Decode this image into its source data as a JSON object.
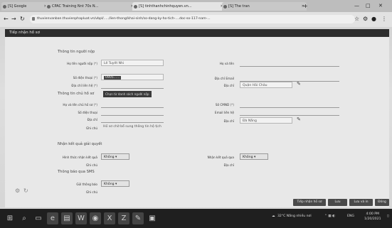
{
  "browser": {
    "tabs": [
      {
        "label": "[S] Google",
        "active": false
      },
      {
        "label": "CPAC Training Nnt 70s N...",
        "active": false
      },
      {
        "label": "[S] tinhthanhchinhquyen.vn...",
        "active": true
      },
      {
        "label": "[S] The tran",
        "active": false
      }
    ],
    "new_tab_icon": "plus-icon",
    "url": "thuvienvanban.thuvienphapluat.vn/vbpl/...../lien-thong/khai-sinh/so-dang-ky-ho-tich-....doc-so-117-nam-...",
    "controls": {
      "minimize": "—",
      "maximize": "□",
      "close": "✕"
    }
  },
  "app": {
    "header_title": "Tiếp nhận hồ sơ",
    "section1": {
      "title": "Thông tin người nộp",
      "left_fields": [
        {
          "label": "Họ tên người nộp",
          "required": true,
          "value": "Lê Tuyết Nhi",
          "kind": "box"
        },
        {
          "label": "Số điện thoại",
          "required": true,
          "value": "0905......",
          "kind": "highlight"
        },
        {
          "label": "Địa chỉ liên hệ",
          "required": true,
          "value": "",
          "kind": "plain"
        }
      ],
      "right_fields": [
        {
          "label": "Họ và tên",
          "required": false,
          "value": "",
          "kind": "plain"
        },
        {
          "label": "Địa chỉ Email",
          "required": false,
          "value": "",
          "kind": "plain"
        },
        {
          "label": "Địa chỉ",
          "required": false,
          "value": "Quận Hải Châu",
          "kind": "box"
        }
      ]
    },
    "section2": {
      "title": "Thông tin chủ hồ sơ",
      "tooltip": "Chọn từ danh sách người nộp",
      "left_fields": [
        {
          "label": "Họ và tên chủ hồ sơ",
          "required": true,
          "value": "",
          "kind": "plain"
        },
        {
          "label": "Số điện thoại",
          "required": false,
          "value": "",
          "kind": "plain"
        },
        {
          "label": "Địa chỉ",
          "required": false,
          "value": "",
          "kind": "plain"
        },
        {
          "label": "Ghi chú",
          "required": false,
          "value": "Hồ sơ chờ bổ sung thông tin hộ tịch",
          "kind": "plain"
        }
      ],
      "right_fields": [
        {
          "label": "Số CMND",
          "required": true,
          "value": "",
          "kind": "plain"
        },
        {
          "label": "Email liên hệ",
          "required": false,
          "value": "",
          "kind": "plain"
        },
        {
          "label": "Địa chỉ",
          "required": false,
          "value": "Đà Nẵng",
          "kind": "box"
        }
      ]
    },
    "section3": {
      "title": "Nhận kết quả giải quyết",
      "left_fields": [
        {
          "label": "Hình thức nhận kết quả",
          "required": false,
          "value": "Không",
          "kind": "select"
        },
        {
          "label": "Ghi chú",
          "required": false,
          "value": "",
          "kind": "plain"
        }
      ],
      "right_fields": [
        {
          "label": "Nhận kết quả qua",
          "required": false,
          "value": "Không",
          "kind": "select"
        },
        {
          "label": "Địa chỉ",
          "required": false,
          "value": "",
          "kind": "plain"
        }
      ]
    },
    "section4": {
      "title": "Thông báo qua SMS",
      "fields": [
        {
          "label": "Gửi thông báo",
          "required": false,
          "value": "Không",
          "kind": "select"
        },
        {
          "label": "Ghi chú",
          "required": false,
          "value": "",
          "kind": "plain"
        }
      ]
    },
    "buttons": [
      {
        "label": "Tiếp nhận hồ sơ"
      },
      {
        "label": "Lưu"
      },
      {
        "label": "Lưu và in"
      },
      {
        "label": "Đóng"
      }
    ]
  },
  "taskbar": {
    "weather": "32°C Nắng nhiều nơi",
    "time": "4:00 PM",
    "date": "1/20/2021",
    "lang": "ENG"
  }
}
